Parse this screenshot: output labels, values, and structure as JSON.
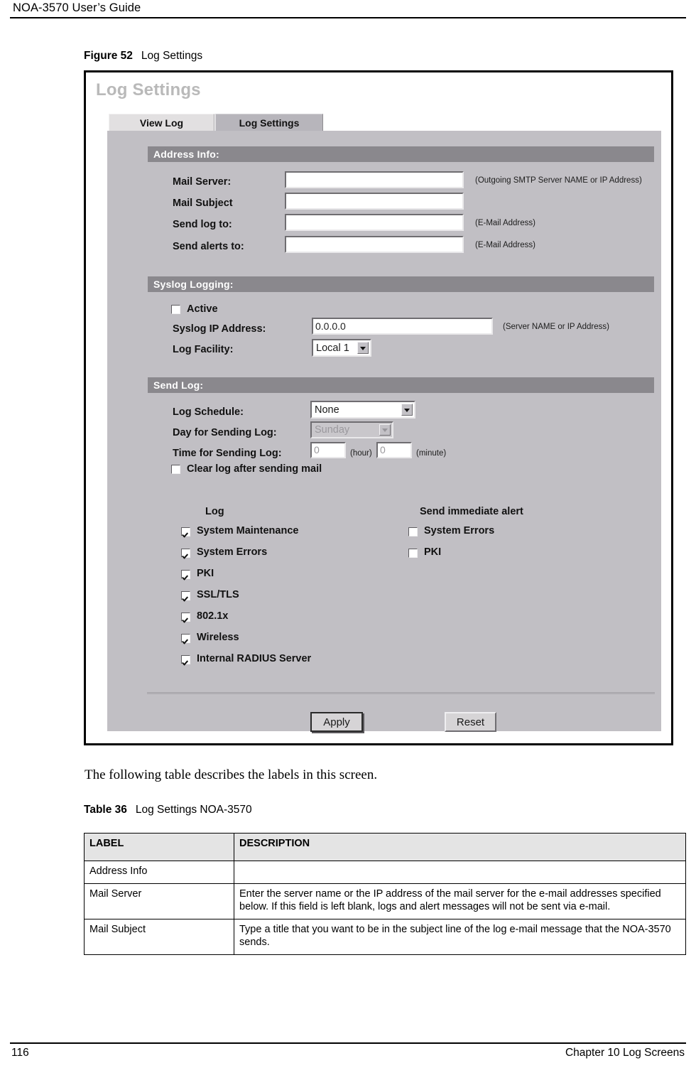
{
  "page": {
    "header_title": "NOA-3570 User’s Guide",
    "footer_page_number": "116",
    "footer_chapter": "Chapter 10 Log Screens",
    "body_paragraph": "The following table describes the labels in this screen."
  },
  "figure": {
    "label": "Figure 52",
    "title": "Log Settings"
  },
  "screenshot": {
    "title": "Log Settings",
    "tabs": [
      {
        "label": "View Log",
        "active": false
      },
      {
        "label": "Log Settings",
        "active": true
      }
    ],
    "sections": {
      "address_info": {
        "header": "Address Info:",
        "fields": [
          {
            "label": "Mail Server:",
            "value": "",
            "hint": "(Outgoing SMTP Server NAME or IP Address)"
          },
          {
            "label": "Mail Subject",
            "value": "",
            "hint": ""
          },
          {
            "label": "Send log to:",
            "value": "",
            "hint": "(E-Mail Address)"
          },
          {
            "label": "Send alerts to:",
            "value": "",
            "hint": "(E-Mail Address)"
          }
        ]
      },
      "syslog_logging": {
        "header": "Syslog Logging:",
        "active_label": "Active",
        "active_checked": false,
        "ip_label": "Syslog IP Address:",
        "ip_value": "0.0.0.0",
        "ip_hint": "(Server NAME or IP Address)",
        "facility_label": "Log Facility:",
        "facility_value": "Local 1"
      },
      "send_log": {
        "header": "Send Log:",
        "schedule_label": "Log Schedule:",
        "schedule_value": "None",
        "day_label": "Day for Sending Log:",
        "day_value": "Sunday",
        "time_label": "Time for Sending Log:",
        "hour_value": "0",
        "hour_unit": "(hour)",
        "minute_value": "0",
        "minute_unit": "(minute)",
        "clear_log_label": "Clear log after sending mail",
        "clear_log_checked": false
      },
      "log_matrix": {
        "col_log": "Log",
        "col_alert": "Send immediate alert",
        "log_items": [
          {
            "label": "System Maintenance",
            "checked": true
          },
          {
            "label": "System Errors",
            "checked": true
          },
          {
            "label": "PKI",
            "checked": true
          },
          {
            "label": "SSL/TLS",
            "checked": true
          },
          {
            "label": "802.1x",
            "checked": true
          },
          {
            "label": "Wireless",
            "checked": true
          },
          {
            "label": "Internal RADIUS Server",
            "checked": true
          }
        ],
        "alert_items": [
          {
            "label": "System Errors",
            "checked": false
          },
          {
            "label": "PKI",
            "checked": false
          }
        ]
      }
    },
    "buttons": {
      "apply": "Apply",
      "reset": "Reset"
    }
  },
  "table": {
    "label": "Table 36",
    "title": "Log Settings NOA-3570",
    "headers": [
      "LABEL",
      "DESCRIPTION"
    ],
    "rows": [
      {
        "label": "Address Info",
        "description": ""
      },
      {
        "label": "Mail Server",
        "description": "Enter the server name or the IP address of the mail server for the e-mail addresses specified below. If this field is left blank, logs and alert messages will not be sent via e-mail."
      },
      {
        "label": "Mail Subject",
        "description": "Type a title that you want to be in the subject line of the log e-mail message that the NOA-3570 sends."
      }
    ]
  },
  "colors": {
    "panel_bg": "#c1bfc4",
    "section_bar": "#8a888d",
    "tab_active": "#b7b5bb",
    "tab_inactive": "#e2e0e1",
    "title_gray": "#b9b9b9",
    "table_header_bg": "#e4e4e4"
  }
}
